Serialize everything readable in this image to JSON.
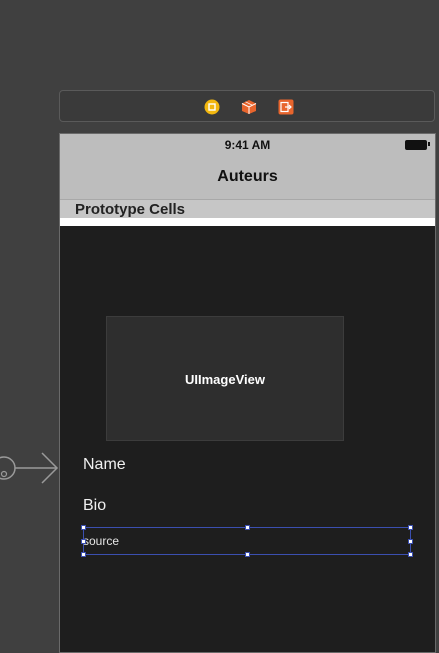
{
  "dock": {
    "icons": [
      "view-controller-icon",
      "first-responder-icon",
      "exit-icon"
    ]
  },
  "device": {
    "status_time": "9:41 AM",
    "nav_title": "Auteurs",
    "prototype_cells_label": "Prototype Cells",
    "image_view_label": "UIImageView",
    "name_label": "Name",
    "bio_label": "Bio",
    "source_text": "source"
  },
  "colors": {
    "canvas_bg": "#404040",
    "device_bg": "#1e1e1e",
    "nav_bg": "#bdbdbd",
    "selection": "#3b4fb0"
  }
}
